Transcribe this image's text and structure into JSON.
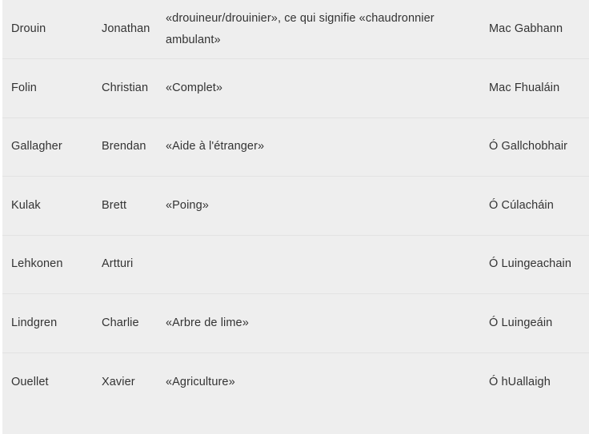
{
  "table": {
    "columns": [
      {
        "key": "surname",
        "name": "surname-column"
      },
      {
        "key": "firstname",
        "name": "first-name-column"
      },
      {
        "key": "meaning",
        "name": "meaning-column"
      },
      {
        "key": "irish",
        "name": "irish-form-column"
      }
    ],
    "rows": [
      {
        "surname": "Drouin",
        "firstname": "Jonathan",
        "meaning": "«drouineur/drouinier», ce qui signifie «chaudronnier ambulant»",
        "irish": "Mac Gabhann"
      },
      {
        "surname": "Folin",
        "firstname": "Christian",
        "meaning": "«Complet»",
        "irish": "Mac Fhualáin"
      },
      {
        "surname": "Gallagher",
        "firstname": "Brendan",
        "meaning": "«Aide à l'étranger»",
        "irish": "Ó Gallchobhair"
      },
      {
        "surname": "Kulak",
        "firstname": "Brett",
        "meaning": "«Poing»",
        "irish": "Ó Cúlacháin"
      },
      {
        "surname": "Lehkonen",
        "firstname": "Artturi",
        "meaning": "",
        "irish": "Ó Luingeachain"
      },
      {
        "surname": "Lindgren",
        "firstname": "Charlie",
        "meaning": "«Arbre de lime»",
        "irish": "Ó Luingeáin"
      },
      {
        "surname": "Ouellet",
        "firstname": "Xavier",
        "meaning": "«Agriculture»",
        "irish": "Ó hUallaigh"
      }
    ]
  },
  "style": {
    "row_background": "#eeeeee",
    "row_divider": "#e2e2e2",
    "text_color": "#333333",
    "page_background": "#ffffff"
  }
}
